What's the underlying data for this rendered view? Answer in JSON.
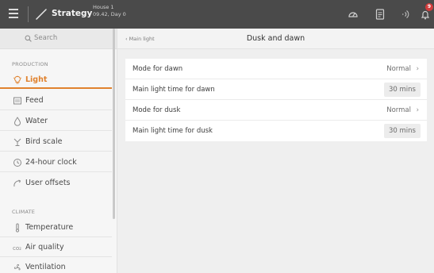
{
  "topbar": {
    "strategy_label": "Strategy",
    "house_name": "House 1",
    "time_day": "09.42, Day 0",
    "notification_count": "9"
  },
  "sidebar": {
    "search_placeholder": "Search",
    "sections": [
      {
        "title": "PRODUCTION",
        "items": [
          {
            "label": "Light",
            "icon": "bulb-icon",
            "active": true
          },
          {
            "label": "Feed",
            "icon": "feed-icon"
          },
          {
            "label": "Water",
            "icon": "water-drop-icon"
          },
          {
            "label": "Bird scale",
            "icon": "bird-scale-icon"
          },
          {
            "label": "24-hour clock",
            "icon": "clock-icon"
          },
          {
            "label": "User offsets",
            "icon": "user-offsets-icon"
          }
        ]
      },
      {
        "title": "CLIMATE",
        "items": [
          {
            "label": "Temperature",
            "icon": "thermometer-icon"
          },
          {
            "label": "Air quality",
            "icon": "co2-icon"
          },
          {
            "label": "Ventilation",
            "icon": "fan-icon"
          }
        ]
      }
    ]
  },
  "content": {
    "back_label": "Main light",
    "title": "Dusk and dawn",
    "rows": [
      {
        "label": "Mode for dawn",
        "value": "Normal",
        "type": "select"
      },
      {
        "label": "Main light time for dawn",
        "value": "30 mins",
        "type": "input"
      },
      {
        "label": "Mode for dusk",
        "value": "Normal",
        "type": "select"
      },
      {
        "label": "Main light time for dusk",
        "value": "30 mins",
        "type": "input"
      }
    ]
  },
  "colors": {
    "accent": "#e0822e",
    "topbar": "#4a4a4a",
    "badge": "#d33c3c"
  }
}
